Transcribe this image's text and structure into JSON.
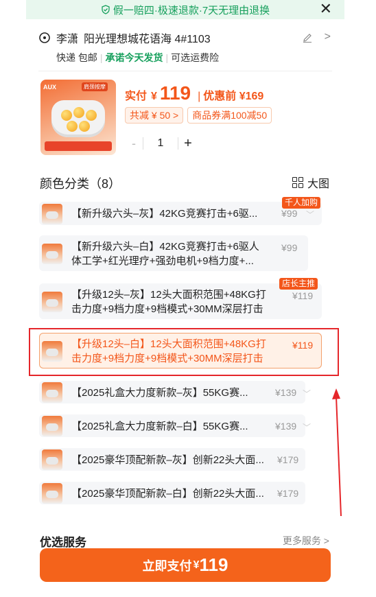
{
  "banner": {
    "text": "假一赔四·极速退款·7天无理由退换"
  },
  "address": {
    "name": "李潇",
    "detail": "阳光理想城花语海 4#1103",
    "shipping": "快递 包邮",
    "promise": "承诺今天发货",
    "freight": "可选运费险"
  },
  "product": {
    "image_brand": "AUX",
    "image_badge": "肩颈按摩",
    "price_label": "实付",
    "currency": "¥",
    "price": "119",
    "original_label": "优惠前 ¥169",
    "discount_chip": "共减 ¥ 50 >",
    "coupon_chip": "商品券满100减50",
    "quantity": "1"
  },
  "section": {
    "title": "颜色分类（8）",
    "big_view": "大图"
  },
  "options": [
    {
      "text": "【新升级六头–灰】42KG竞赛打击+6驱...",
      "price": "¥99",
      "badge": "千人加购",
      "selected": false
    },
    {
      "text": "【新升级六头–白】42KG竞赛打击+6驱人",
      "text2": "体工学+红光理疗+强劲电机+9档力度+...",
      "price": "¥99",
      "selected": false
    },
    {
      "text": "【升级12头–灰】12头大面积范围+48KG打",
      "text2": "击力度+9档力度+9档模式+30MM深层打击",
      "price": "¥119",
      "badge": "店长主推",
      "selected": false
    },
    {
      "text": "【升级12头–白】12头大面积范围+48KG打",
      "text2": "击力度+9档力度+9档模式+30MM深层打击",
      "price": "¥119",
      "selected": true
    },
    {
      "text": "【2025礼盒大力度新款–灰】55KG赛...",
      "price": "¥139",
      "selected": false
    },
    {
      "text": "【2025礼盒大力度新款–白】55KG赛...",
      "price": "¥139",
      "selected": false
    },
    {
      "text": "【2025豪华顶配新款–灰】创新22头大面...",
      "price": "¥179",
      "selected": false
    },
    {
      "text": "【2025豪华顶配新款–白】创新22头大面...",
      "price": "¥179",
      "selected": false
    }
  ],
  "services": {
    "title": "优选服务",
    "more": "更多服务 >"
  },
  "pay": {
    "label": "立即支付",
    "currency": "¥",
    "amount": "119"
  },
  "colors": {
    "accent": "#f4631b",
    "green": "#17a05d",
    "annotation": "#e5262a"
  }
}
